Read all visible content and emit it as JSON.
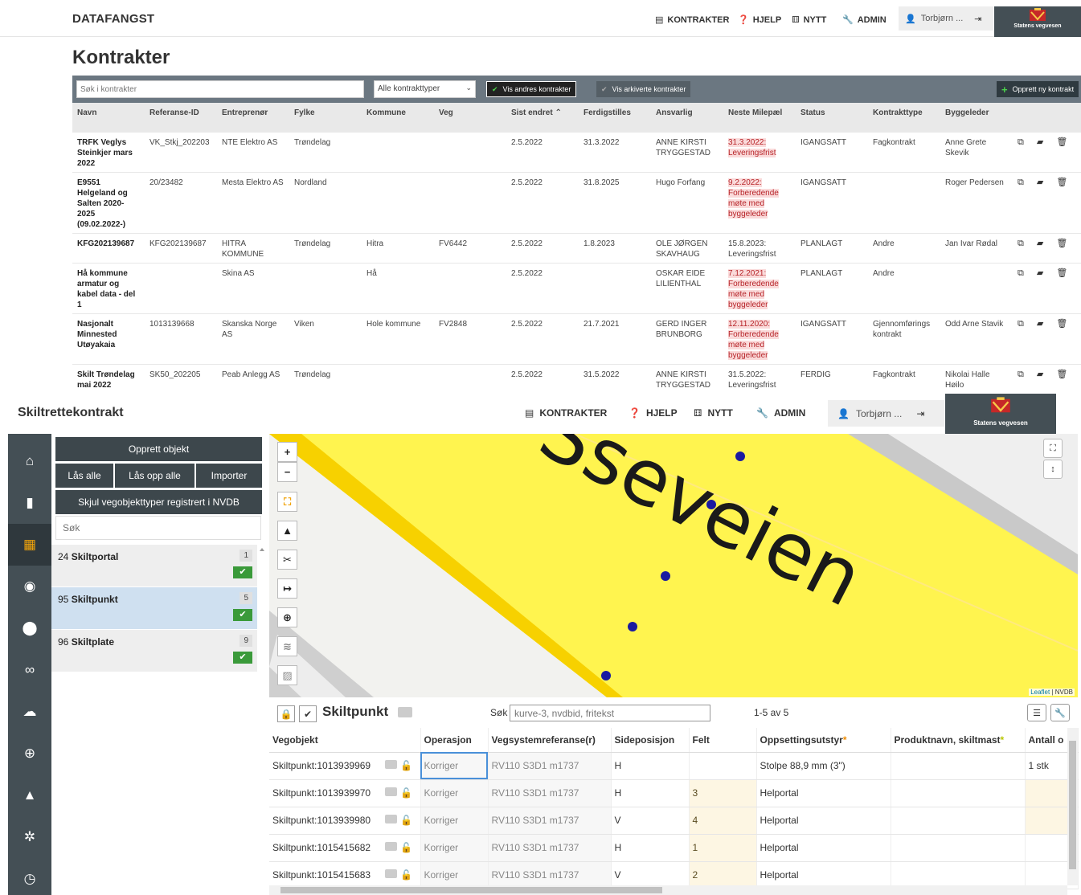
{
  "top": {
    "brand": "DATAFANGST",
    "nav": {
      "kontrakter": "KONTRAKTER",
      "hjelp": "HJELP",
      "nytt": "NYTT",
      "admin": "ADMIN",
      "user": "Torbjørn ..."
    },
    "logo_text": "Statens vegvesen",
    "page_title": "Kontrakter",
    "filters": {
      "search_placeholder": "Søk i kontrakter",
      "type_select": "Alle kontrakttyper",
      "show_others": "Vis andres kontrakter",
      "show_archived": "Vis arkiverte kontrakter",
      "create_new": "Opprett ny kontrakt"
    },
    "columns": [
      "Navn",
      "Referanse-ID",
      "Entreprenør",
      "Fylke",
      "Kommune",
      "Veg",
      "Sist endret",
      "Ferdigstilles",
      "Ansvarlig",
      "Neste Milepæl",
      "Status",
      "Kontrakttype",
      "Byggeleder"
    ],
    "rows": [
      {
        "navn": "TRFK Veglys Steinkjer mars 2022",
        "ref": "VK_Stkj_202203",
        "entreprenor": "NTE Elektro AS",
        "fylke": "Trøndelag",
        "kommune": "",
        "veg": "",
        "sist": "2.5.2022",
        "ferdig": "31.3.2022",
        "ansvarlig": "ANNE KIRSTI TRYGGESTAD",
        "milepael": "31.3.2022: Leveringsfrist",
        "overdue": true,
        "status": "IGANGSATT",
        "type": "Fagkontrakt",
        "byggeleder": "Anne Grete Skevik"
      },
      {
        "navn": "E9551 Helgeland og Salten 2020-2025 (09.02.2022-)",
        "ref": "20/23482",
        "entreprenor": "Mesta Elektro AS",
        "fylke": "Nordland",
        "kommune": "",
        "veg": "",
        "sist": "2.5.2022",
        "ferdig": "31.8.2025",
        "ansvarlig": "Hugo Forfang",
        "milepael": "9.2.2022: Forberedende møte med byggeleder",
        "overdue": true,
        "status": "IGANGSATT",
        "type": "",
        "byggeleder": "Roger Pedersen"
      },
      {
        "navn": "KFG202139687",
        "ref": "KFG202139687",
        "entreprenor": "HITRA KOMMUNE",
        "fylke": "Trøndelag",
        "kommune": "Hitra",
        "veg": "FV6442",
        "sist": "2.5.2022",
        "ferdig": "1.8.2023",
        "ansvarlig": "OLE JØRGEN SKAVHAUG",
        "milepael": "15.8.2023: Leveringsfrist",
        "overdue": false,
        "status": "PLANLAGT",
        "type": "Andre",
        "byggeleder": "Jan Ivar Rødal"
      },
      {
        "navn": "Hå kommune armatur og kabel data - del 1",
        "ref": "",
        "entreprenor": "Skina AS",
        "fylke": "",
        "kommune": "Hå",
        "veg": "",
        "sist": "2.5.2022",
        "ferdig": "",
        "ansvarlig": "OSKAR EIDE LILIENTHAL",
        "milepael": "7.12.2021: Forberedende møte med byggeleder",
        "overdue": true,
        "status": "PLANLAGT",
        "type": "Andre",
        "byggeleder": ""
      },
      {
        "navn": "Nasjonalt Minnested Utøyakaia",
        "ref": "1013139668",
        "entreprenor": "Skanska Norge AS",
        "fylke": "Viken",
        "kommune": "Hole kommune",
        "veg": "FV2848",
        "sist": "2.5.2022",
        "ferdig": "21.7.2021",
        "ansvarlig": "GERD INGER BRUNBORG",
        "milepael": "12.11.2020: Forberedende møte med byggeleder",
        "overdue": true,
        "status": "IGANGSATT",
        "type": "Gjennomførings kontrakt",
        "byggeleder": "Odd Arne Stavik"
      },
      {
        "navn": "Skilt Trøndelag mai 2022",
        "ref": "SK50_202205",
        "entreprenor": "Peab Anlegg AS",
        "fylke": "Trøndelag",
        "kommune": "",
        "veg": "",
        "sist": "2.5.2022",
        "ferdig": "31.5.2022",
        "ansvarlig": "ANNE KIRSTI TRYGGESTAD",
        "milepael": "31.5.2022: Leveringsfrist",
        "overdue": false,
        "status": "FERDIG",
        "type": "Fagkontrakt",
        "byggeleder": "Nikolai Halle Høilo"
      }
    ]
  },
  "bottom": {
    "title": "Skiltrettekontrakt",
    "nav": {
      "kontrakter": "KONTRAKTER",
      "hjelp": "HJELP",
      "nytt": "NYTT",
      "admin": "ADMIN",
      "user": "Torbjørn ..."
    },
    "logo_text": "Statens vegvesen",
    "panel": {
      "opprett": "Opprett objekt",
      "las_alle": "Lås alle",
      "las_opp_alle": "Lås opp alle",
      "importer": "Importer",
      "skjul": "Skjul vegobjekttyper registrert i NVDB",
      "search_placeholder": "Søk",
      "types": [
        {
          "id": "24",
          "name": "Skiltportal",
          "count": "1"
        },
        {
          "id": "95",
          "name": "Skiltpunkt",
          "count": "5"
        },
        {
          "id": "96",
          "name": "Skiltplate",
          "count": "9"
        }
      ]
    },
    "map": {
      "road_label": "Sseveien",
      "attribution_link": "Leaflet",
      "attribution_sep": " | ",
      "attribution_src": "NVDB"
    },
    "grid": {
      "title": "Skiltpunkt",
      "search_label": "Søk",
      "search_placeholder": "kurve-3, nvdbid, fritekst",
      "count": "1-5 av 5",
      "columns": [
        "Vegobjekt",
        "Operasjon",
        "Vegsystemreferanse(r)",
        "Sideposisjon",
        "Felt",
        "Oppsettingsutstyr",
        "Produktnavn, skiltmast",
        "Antall o"
      ],
      "rows": [
        {
          "obj": "Skiltpunkt:1013939969",
          "op": "Korriger",
          "ref": "RV110 S3D1 m1737",
          "side": "H",
          "felt": "",
          "utstyr": "Stolpe 88,9 mm (3\")",
          "produkt": "",
          "antall": "1 stk"
        },
        {
          "obj": "Skiltpunkt:1013939970",
          "op": "Korriger",
          "ref": "RV110 S3D1 m1737",
          "side": "H",
          "felt": "3",
          "utstyr": "Helportal",
          "produkt": "",
          "antall": ""
        },
        {
          "obj": "Skiltpunkt:1013939980",
          "op": "Korriger",
          "ref": "RV110 S3D1 m1737",
          "side": "V",
          "felt": "4",
          "utstyr": "Helportal",
          "produkt": "",
          "antall": ""
        },
        {
          "obj": "Skiltpunkt:1015415682",
          "op": "Korriger",
          "ref": "RV110 S3D1 m1737",
          "side": "H",
          "felt": "1",
          "utstyr": "Helportal",
          "produkt": "",
          "antall": ""
        },
        {
          "obj": "Skiltpunkt:1015415683",
          "op": "Korriger",
          "ref": "RV110 S3D1 m1737",
          "side": "V",
          "felt": "2",
          "utstyr": "Helportal",
          "produkt": "",
          "antall": ""
        }
      ]
    }
  },
  "colors": {
    "dark": "#444f55",
    "accent": "#f0a30a",
    "road": "#fff44f",
    "marker": "#1a1aa0",
    "overdue_bg": "#fadada",
    "overdue_text": "#b7252a"
  }
}
